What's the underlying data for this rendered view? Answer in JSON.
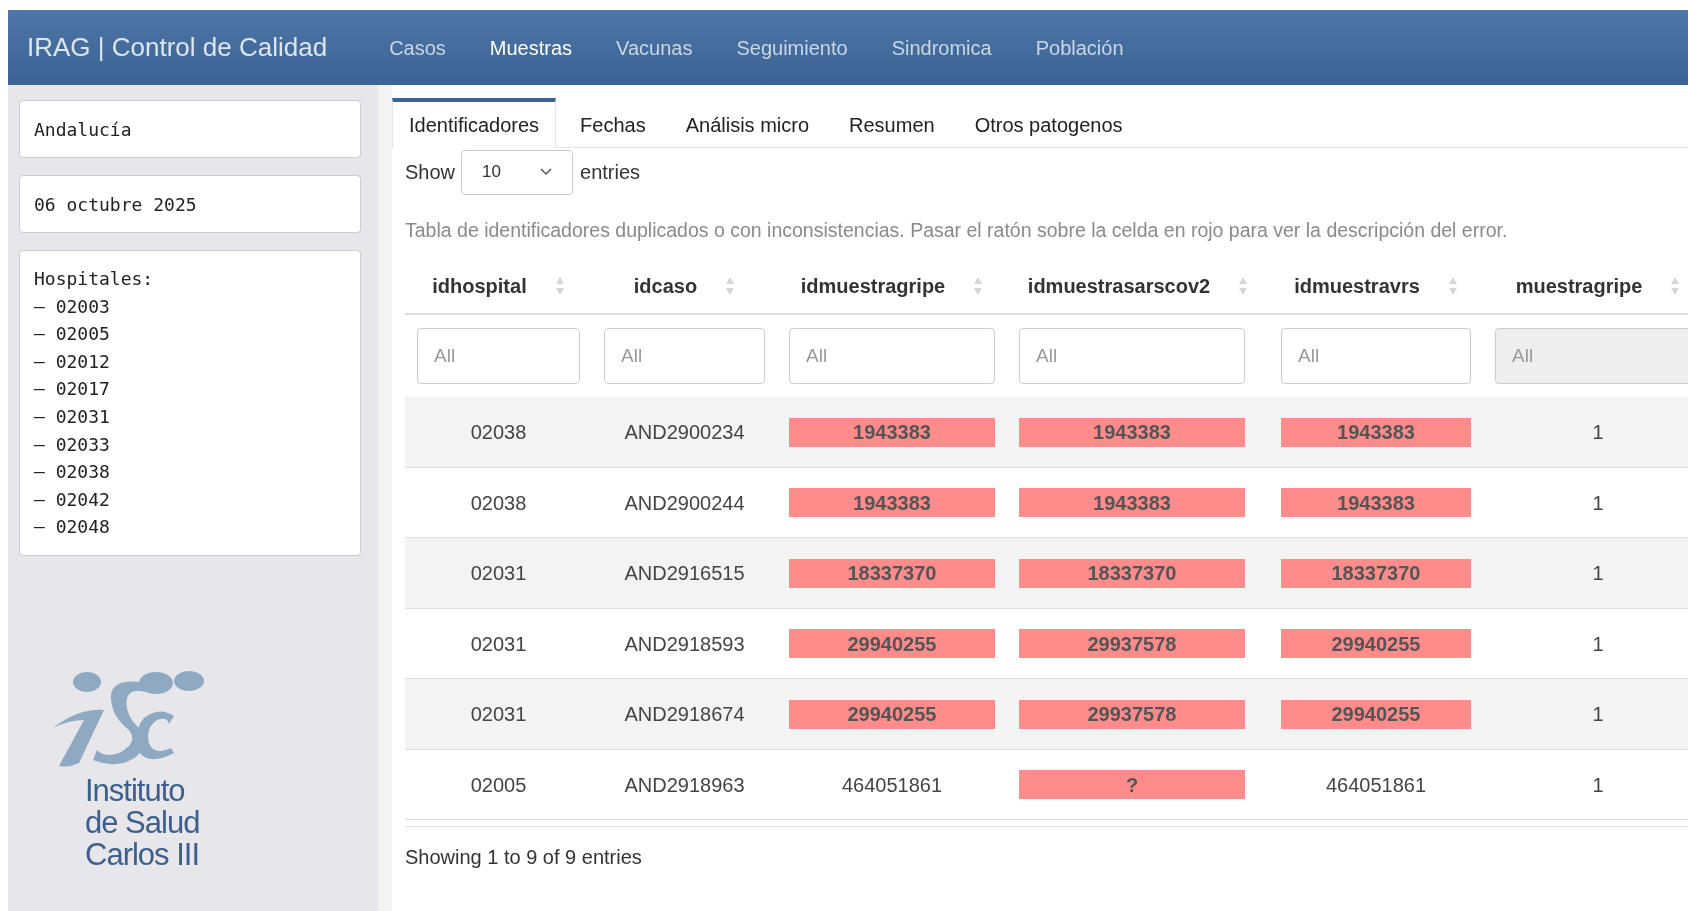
{
  "navbar": {
    "brand": "IRAG | Control de Calidad",
    "items": [
      {
        "label": "Casos",
        "selected": false
      },
      {
        "label": "Muestras",
        "selected": true
      },
      {
        "label": "Vacunas",
        "selected": false
      },
      {
        "label": "Seguimiento",
        "selected": false
      },
      {
        "label": "Sindromica",
        "selected": false
      },
      {
        "label": "Población",
        "selected": false
      }
    ]
  },
  "sidebar": {
    "region": "Andalucía",
    "date": "06 octubre 2025",
    "hospitals_label": "Hospitales:",
    "hospitals": [
      "– 02003",
      "– 02005",
      "– 02012",
      "– 02017",
      "– 02031",
      "– 02033",
      "– 02038",
      "– 02042",
      "– 02048"
    ],
    "logo_lines": [
      "Instituto",
      "de Salud",
      "Carlos III"
    ]
  },
  "tabs": [
    {
      "label": "Identificadores",
      "selected": true
    },
    {
      "label": "Fechas",
      "selected": false
    },
    {
      "label": "Análisis micro",
      "selected": false
    },
    {
      "label": "Resumen",
      "selected": false
    },
    {
      "label": "Otros patogenos",
      "selected": false
    }
  ],
  "length_control": {
    "before": "Show",
    "value": "10",
    "after": "entries"
  },
  "caption": "Tabla de identificadores duplicados o con inconsistencias. Pasar el ratón sobre la celda en rojo para ver la descripción del error.",
  "table": {
    "columns": [
      "idhospital",
      "idcaso",
      "idmuestragripe",
      "idmuestrasarscov2",
      "idmuestravrs",
      "muestragripe"
    ],
    "filters": [
      {
        "placeholder": "All",
        "disabled": false
      },
      {
        "placeholder": "All",
        "disabled": false
      },
      {
        "placeholder": "All",
        "disabled": false
      },
      {
        "placeholder": "All",
        "disabled": false
      },
      {
        "placeholder": "All",
        "disabled": false
      },
      {
        "placeholder": "All",
        "disabled": true
      }
    ],
    "rows": [
      [
        {
          "text": "02038",
          "flagged": false
        },
        {
          "text": "AND2900234",
          "flagged": false
        },
        {
          "text": "1943383",
          "flagged": true
        },
        {
          "text": "1943383",
          "flagged": true
        },
        {
          "text": "1943383",
          "flagged": true
        },
        {
          "text": "1",
          "flagged": false
        }
      ],
      [
        {
          "text": "02038",
          "flagged": false
        },
        {
          "text": "AND2900244",
          "flagged": false
        },
        {
          "text": "1943383",
          "flagged": true
        },
        {
          "text": "1943383",
          "flagged": true
        },
        {
          "text": "1943383",
          "flagged": true
        },
        {
          "text": "1",
          "flagged": false
        }
      ],
      [
        {
          "text": "02031",
          "flagged": false
        },
        {
          "text": "AND2916515",
          "flagged": false
        },
        {
          "text": "18337370",
          "flagged": true
        },
        {
          "text": "18337370",
          "flagged": true
        },
        {
          "text": "18337370",
          "flagged": true
        },
        {
          "text": "1",
          "flagged": false
        }
      ],
      [
        {
          "text": "02031",
          "flagged": false
        },
        {
          "text": "AND2918593",
          "flagged": false
        },
        {
          "text": "29940255",
          "flagged": true
        },
        {
          "text": "29937578",
          "flagged": true
        },
        {
          "text": "29940255",
          "flagged": true
        },
        {
          "text": "1",
          "flagged": false
        }
      ],
      [
        {
          "text": "02031",
          "flagged": false
        },
        {
          "text": "AND2918674",
          "flagged": false
        },
        {
          "text": "29940255",
          "flagged": true
        },
        {
          "text": "29937578",
          "flagged": true
        },
        {
          "text": "29940255",
          "flagged": true
        },
        {
          "text": "1",
          "flagged": false
        }
      ],
      [
        {
          "text": "02005",
          "flagged": false
        },
        {
          "text": "AND2918963",
          "flagged": false
        },
        {
          "text": "464051861",
          "flagged": false
        },
        {
          "text": "?",
          "flagged": true
        },
        {
          "text": "464051861",
          "flagged": false
        },
        {
          "text": "1",
          "flagged": false
        }
      ]
    ]
  },
  "footer": "Showing 1 to 9 of 9 entries"
}
